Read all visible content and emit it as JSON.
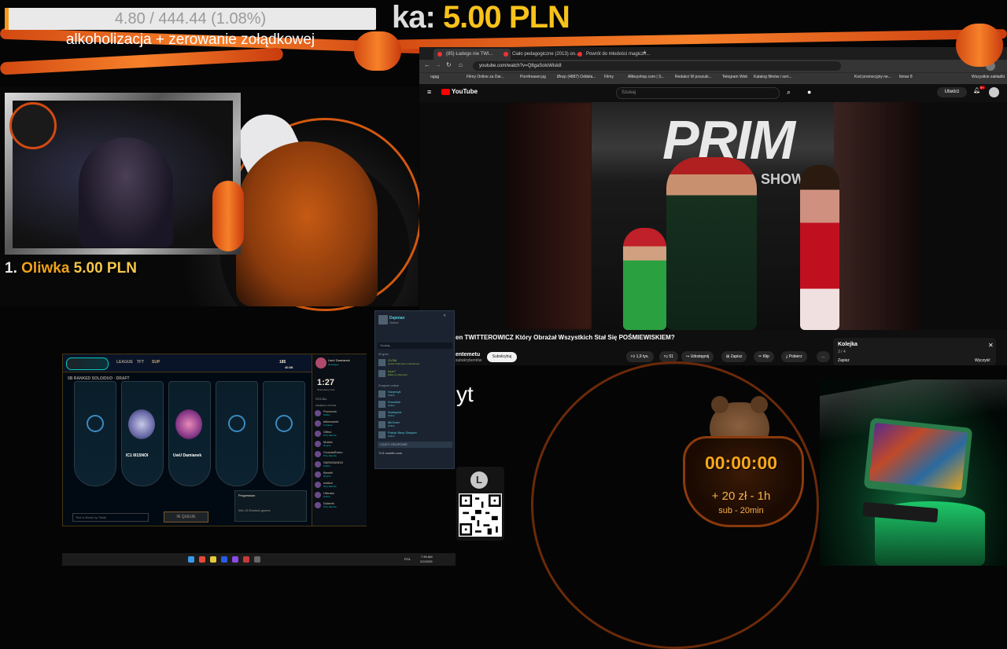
{
  "goal": {
    "text": "4.80 / 444.44 (1.08%)",
    "progress": 0.0108,
    "title": "alkoholizacja + zerowanie zołądkowej"
  },
  "donation_alert": {
    "prefix": "ka:",
    "amount": "5.00 PLN"
  },
  "top_donor": {
    "rank": "1.",
    "name": "Oliwka",
    "amount": "5.00 PLN"
  },
  "browser": {
    "tabs": [
      "(85) Ładego nie TWI...",
      "Ciało pedagogiczne (2013) on...",
      "Powrót do młodości magiczn..."
    ],
    "url": "youtube.com/watch?v=Q8gaSoloWisk8",
    "bookmarks": [
      "ogąg",
      "Filmy Online za Dar...",
      "Pornfreaser.pg",
      "Ønzp (4887) Oddela...",
      "Filmy",
      "Allkeyshop.com | S...",
      "Redakci W poszuki...",
      "Telegram Web",
      "Katalog filmów i seri...",
      "Kod promocyjny ne...",
      "Ikmar 8",
      "Wszystkie zakładki"
    ]
  },
  "youtube": {
    "logo": "YouTube",
    "search_placeholder": "Szukaj",
    "create_label": "Utwórz",
    "notif_count": "9+",
    "video_overlay_brand": "PRIM",
    "video_overlay_sub": "SHOW M",
    "video_title": "en TWITTEROWICZ Który Obrażał Wszystkich Stał Się POŚMIEWISKIEM?",
    "channel_name": "entemetu",
    "channel_subs": "subskrybentów",
    "subscribe_label": "Subskrybuj",
    "likes": "1,9 tys.",
    "dislikes": "51",
    "share_label": "Udostępnij",
    "save_label": "Zapisz",
    "clip_label": "Klip",
    "download_label": "Pobierz",
    "more_label": "…",
    "queue": {
      "title": "Kolejka",
      "count": "3 / 4",
      "save_label": "Zapisz",
      "clear_label": "Wyczyść"
    }
  },
  "league": {
    "play_label": "",
    "nav": [
      "LEAGUE",
      "TFT",
      "SUP"
    ],
    "currency_be": "185",
    "currency_rp": "40.5K",
    "player_name": "UwU Damianek",
    "player_status": "W Kolejce",
    "queue_title": "5B  RANKED SOLO/DUO · DRAFT",
    "timer": "1:27",
    "timer_label": "Szacowany czas",
    "social_label": "SOCIAL",
    "general_label": "GENERAL ONLINE",
    "slot_names": [
      "IC1 III1SNOI",
      "UwU Damianek"
    ],
    "friends": [
      {
        "name": "Promocio",
        "status": "Online"
      },
      {
        "name": "bittersweet",
        "status": "In Game"
      },
      {
        "name": "Gitino",
        "status": "Przy kliencie"
      },
      {
        "name": "Motivit",
        "status": "W grze"
      },
      {
        "name": "CrusniaRomo",
        "status": "Przy kliencie"
      },
      {
        "name": "SARASANDO",
        "status": "Online"
      },
      {
        "name": "Benelli",
        "status": "W grze"
      },
      {
        "name": "melkul",
        "status": "Przy kliencie"
      },
      {
        "name": "Hibroka",
        "status": "Online"
      },
      {
        "name": "Dolemit",
        "status": "Przy kliencie"
      }
    ],
    "progression_label": "Progression",
    "progression_sub": "Win 15 Ranked games",
    "in_queue_label": "IN QUEUE",
    "chat_placeholder": "Text to Bond by Tiktok"
  },
  "steam": {
    "user": "Dajmian",
    "status": "Online",
    "search_placeholder": "Szukaj...",
    "in_game_label": "W grze",
    "online_label": "Znajomi online",
    "friends_in_game": [
      {
        "name": "GV3M",
        "status": "Grand Theft Auto V Enhanced"
      },
      {
        "name": "tope7",
        "status": "Battle for Wesnoth"
      }
    ],
    "friends_online": [
      {
        "name": "Kacprzyk",
        "status": "Online"
      },
      {
        "name": "Krowskie",
        "status": "Online"
      },
      {
        "name": "hdalayma",
        "status": "Online"
      },
      {
        "name": "MiChaer",
        "status": "Online"
      },
      {
        "name": "Patryk Bazy Świętań",
        "status": "Online"
      }
    ],
    "groups_label": "CZATY GRUPOWE",
    "group_item": "TLS noobifu.com"
  },
  "taskbar": {
    "time": "7:39 AM",
    "date": "2/2/2025",
    "lang": "POL"
  },
  "chat_word": "yt",
  "qr_logo_letter": "L",
  "timer": {
    "value": "00:00:00",
    "rule_1": "+ 20 zł - 1h",
    "rule_2": "sub - 20min"
  },
  "colors": {
    "accent_orange": "#f7812a",
    "gold": "#f7c21a",
    "youtube_red": "#ff0000",
    "league_teal": "#0ac8b9"
  }
}
